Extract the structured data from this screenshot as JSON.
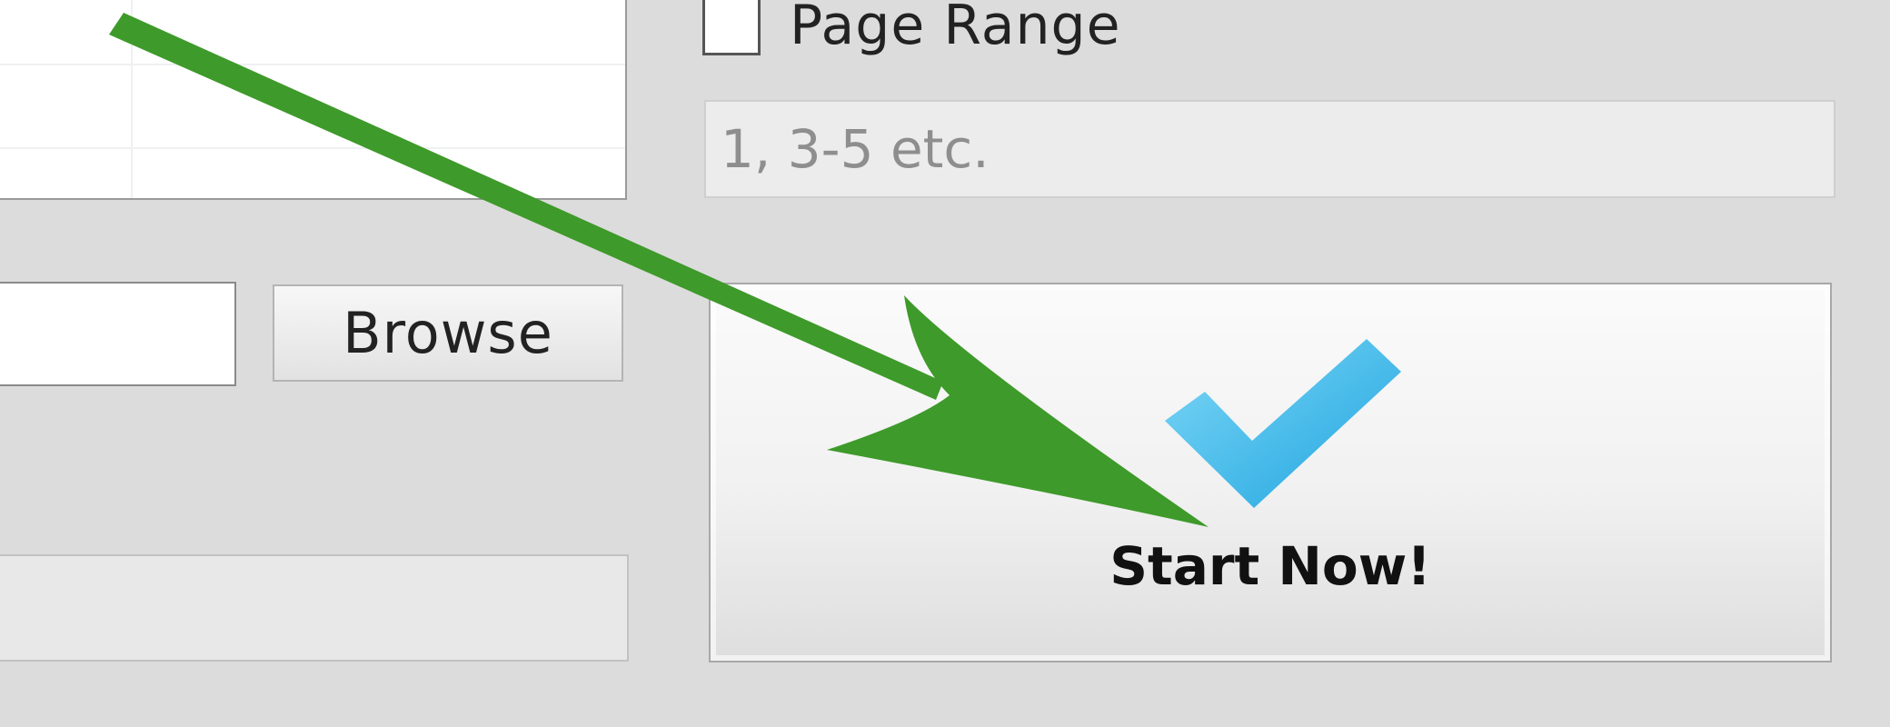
{
  "options": {
    "page_range_label": "Page Range",
    "page_range_checked": false,
    "page_range_placeholder": "1, 3-5 etc."
  },
  "output": {
    "browse_label": "Browse"
  },
  "actions": {
    "start_label": "Start Now!"
  },
  "icons": {
    "start": "checkmark-icon",
    "annotation": "green-arrow-annotation"
  },
  "colors": {
    "background": "#dcdcdc",
    "checkmark": "#3db5e6",
    "annotation_arrow": "#3e9a2a"
  }
}
